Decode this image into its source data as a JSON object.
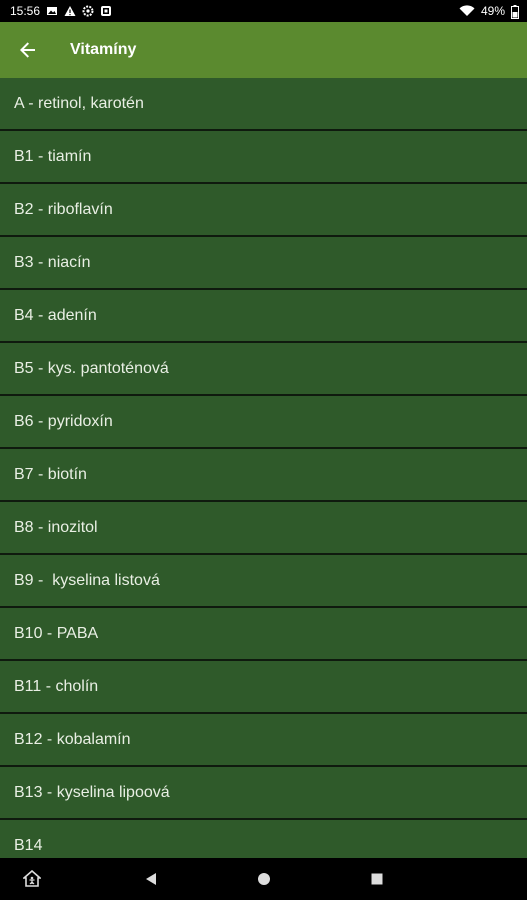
{
  "status_bar": {
    "time": "15:56",
    "battery": "49%",
    "left_icons": [
      "image-icon",
      "warning-icon",
      "settings-icon",
      "app-icon"
    ],
    "right_icons": [
      "wifi-icon",
      "battery-icon"
    ]
  },
  "app_bar": {
    "title": "Vitamíny",
    "back_icon": "arrow-back-icon",
    "color": "#5b8a2f"
  },
  "list": {
    "background": "#2f5a2a",
    "divider": "#0f1a0e",
    "items": [
      {
        "label": "A - retinol, karotén"
      },
      {
        "label": "B1 - tiamín"
      },
      {
        "label": "B2 - riboflavín"
      },
      {
        "label": "B3 - niacín"
      },
      {
        "label": "B4 - adenín"
      },
      {
        "label": "B5 - kys. pantoténová"
      },
      {
        "label": "B6 - pyridoxín"
      },
      {
        "label": "B7 - biotín"
      },
      {
        "label": "B8 - inozitol"
      },
      {
        "label": "B9 -  kyselina listová"
      },
      {
        "label": "B10 - PABA"
      },
      {
        "label": "B11 - cholín"
      },
      {
        "label": "B12 - kobalamín"
      },
      {
        "label": "B13 - kyselina lipoová"
      },
      {
        "label": "B14"
      }
    ]
  },
  "nav_bar": {
    "buttons": [
      "home-accessibility-icon",
      "back-triangle-icon",
      "home-circle-icon",
      "recents-square-icon"
    ]
  }
}
